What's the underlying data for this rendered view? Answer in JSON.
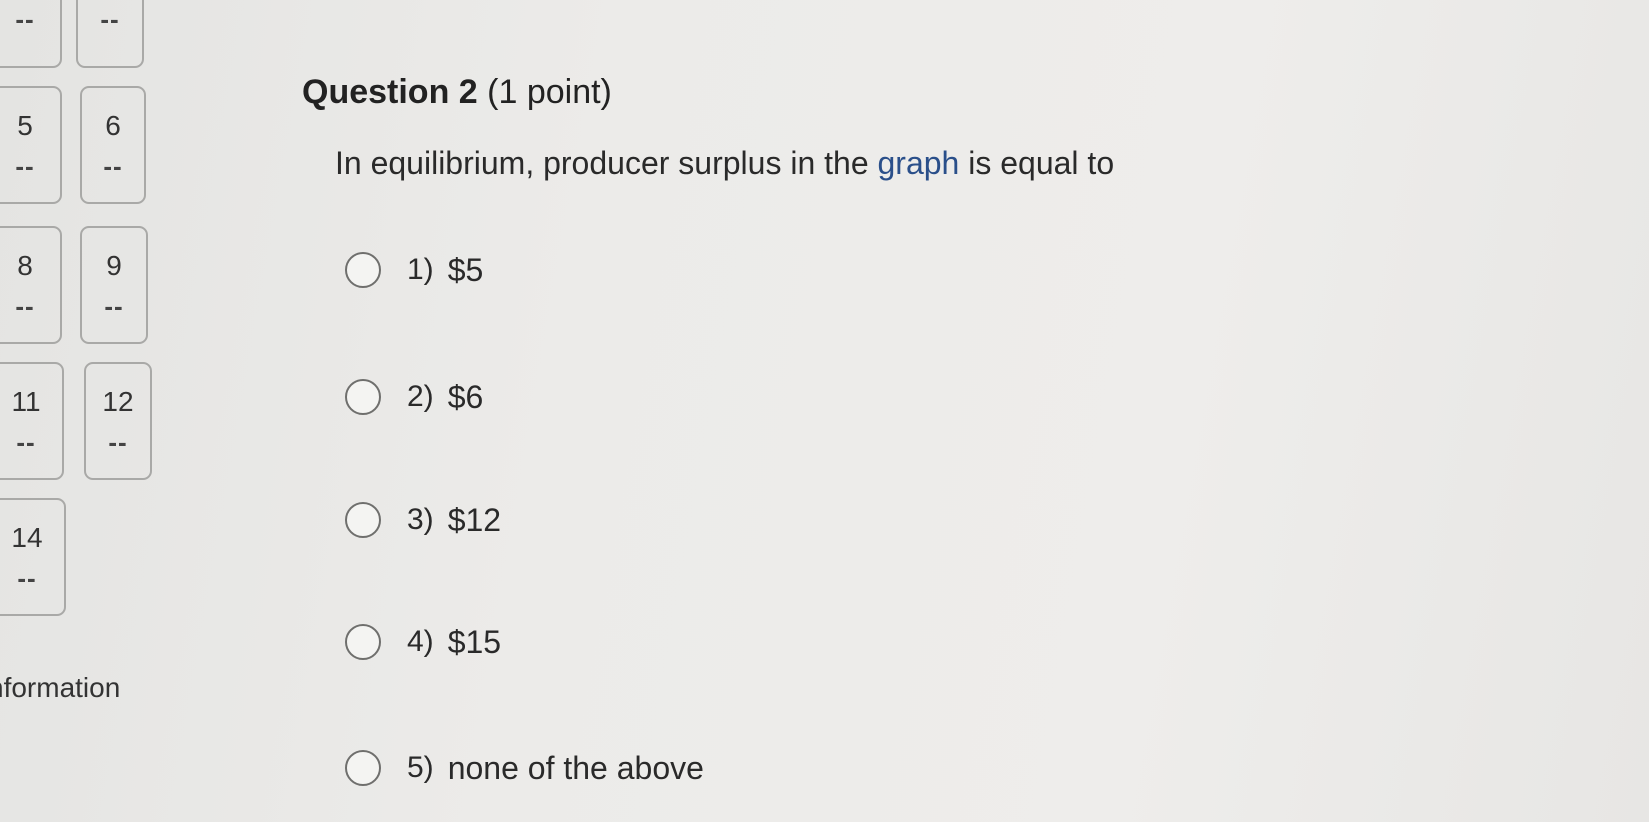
{
  "sidebar": {
    "items": [
      {
        "status": "--"
      },
      {
        "status": "--"
      },
      {
        "number": "5",
        "status": "--"
      },
      {
        "number": "6",
        "status": "--"
      },
      {
        "number": "8",
        "status": "--"
      },
      {
        "number": "9",
        "status": "--"
      },
      {
        "number": "11",
        "status": "--"
      },
      {
        "number": "12",
        "status": "--"
      },
      {
        "number": "14",
        "status": "--"
      }
    ],
    "info_label": "nformation"
  },
  "question": {
    "title_bold": "Question 2",
    "title_points": "(1 point)",
    "text_before": "In equilibrium, producer surplus in the ",
    "text_link": "graph",
    "text_after": " is equal to",
    "options": [
      {
        "number": "1)",
        "label": "$5"
      },
      {
        "number": "2)",
        "label": "$6"
      },
      {
        "number": "3)",
        "label": "$12"
      },
      {
        "number": "4)",
        "label": "$15"
      },
      {
        "number": "5)",
        "label": "none of the above"
      }
    ]
  },
  "colors": {
    "link": "#2a4f8a",
    "background": "#ecebe9"
  }
}
